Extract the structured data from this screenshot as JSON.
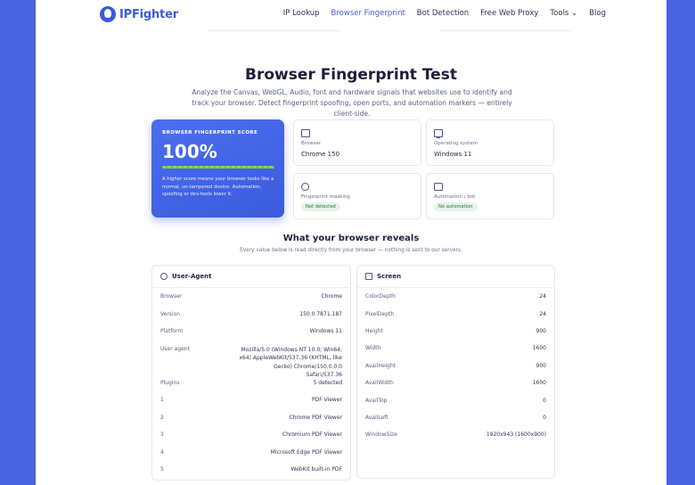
{
  "brand": {
    "name": "IPFighter"
  },
  "nav": {
    "items": [
      "IP Lookup",
      "Browser Fingerprint",
      "Bot Detection",
      "Free Web Proxy",
      "Tools",
      "Blog"
    ],
    "tools_chevron": "⌄"
  },
  "hero": {
    "title": "Browser Fingerprint Test",
    "subtitle": "Analyze the Canvas, WebGL, Audio, font and hardware signals that websites use to identify and track your browser. Detect fingerprint spoofing, open ports, and automation markers — entirely client-side."
  },
  "score": {
    "label": "BROWSER FINGERPRINT SCORE",
    "value": "100%",
    "level": 1.0,
    "text": "A higher score means your browser looks like a normal, un-tampered device. Automation, spoofing or dev-tools lower it."
  },
  "cards": {
    "browser": {
      "label": "Browser",
      "value": "Chrome 150"
    },
    "os": {
      "label": "Operating system",
      "value": "Windows 11"
    },
    "masking": {
      "label": "Fingerprint masking",
      "value": "Not detected"
    },
    "automation": {
      "label": "Automation / bot",
      "value": "No automation"
    }
  },
  "reveals": {
    "title": "What your browser reveals",
    "subtitle": "Every value below is read directly from your browser — nothing is sent to our servers."
  },
  "ua_panel": {
    "title": "User-Agent",
    "rows": [
      {
        "k": "Browser",
        "v": "Chrome"
      },
      {
        "k": "Version",
        "v": "150.0.7871.187"
      },
      {
        "k": "Platform",
        "v": "Windows 11"
      },
      {
        "k": "User agent",
        "v": "Mozilla/5.0 (Windows NT 10.0; Win64; x64) AppleWebKit/537.36 (KHTML, like Gecko) Chrome/150.0.0.0 Safari/537.36"
      },
      {
        "k": "Plugins",
        "v": "5 detected"
      },
      {
        "k": "1",
        "v": "PDF Viewer"
      },
      {
        "k": "2",
        "v": "Chrome PDF Viewer"
      },
      {
        "k": "3",
        "v": "Chromium PDF Viewer"
      },
      {
        "k": "4",
        "v": "Microsoft Edge PDF Viewer"
      },
      {
        "k": "5",
        "v": "WebKit built-in PDF"
      }
    ]
  },
  "screen_panel": {
    "title": "Screen",
    "rows": [
      {
        "k": "ColorDepth",
        "v": "24"
      },
      {
        "k": "PixelDepth",
        "v": "24"
      },
      {
        "k": "Height",
        "v": "900"
      },
      {
        "k": "Width",
        "v": "1600"
      },
      {
        "k": "AvailHeight",
        "v": "900"
      },
      {
        "k": "AvailWidth",
        "v": "1600"
      },
      {
        "k": "AvailTop",
        "v": "0"
      },
      {
        "k": "AvailLeft",
        "v": "0"
      },
      {
        "k": "WindowSize",
        "v": "1920x943 (1600x900)"
      }
    ]
  }
}
